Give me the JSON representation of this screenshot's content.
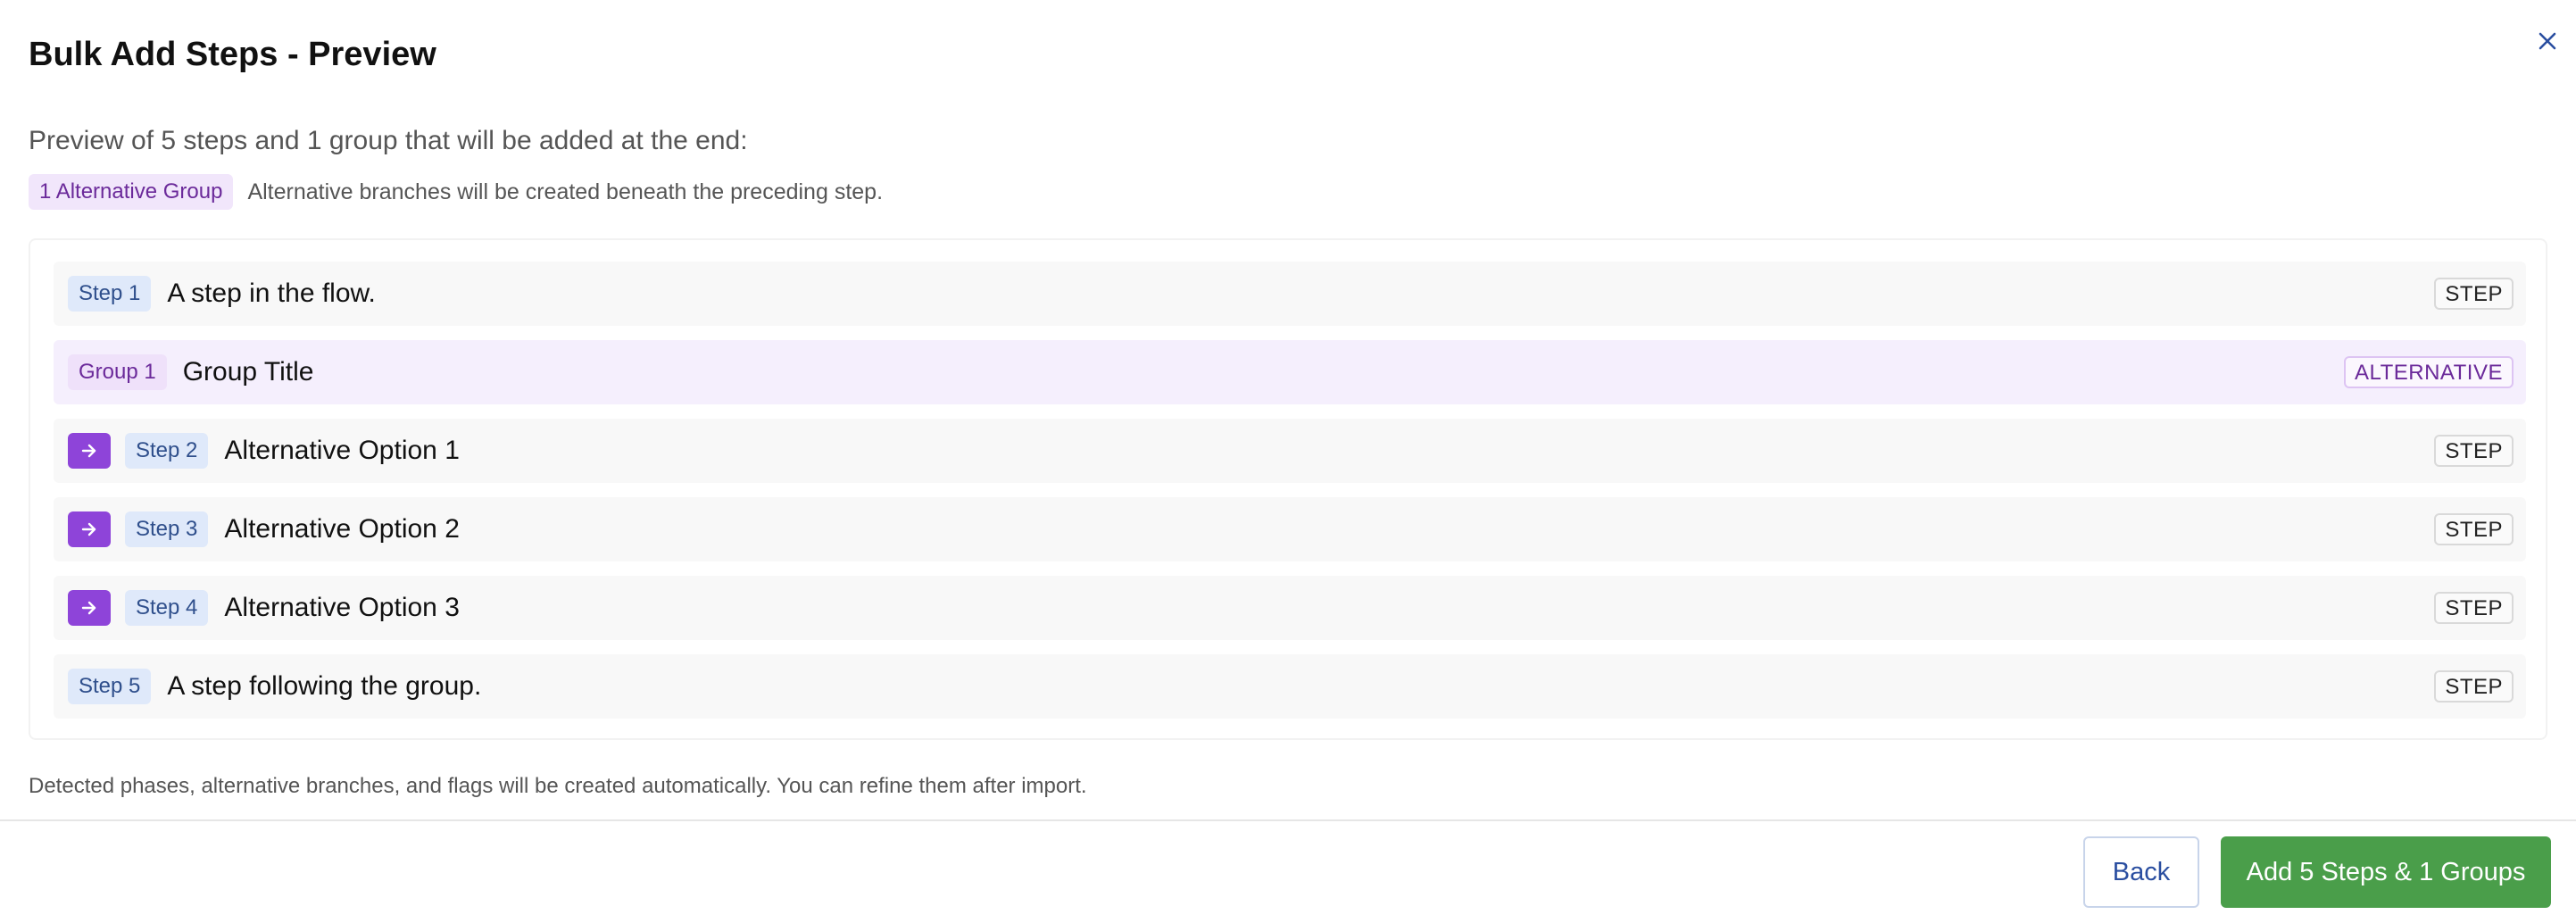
{
  "dialog": {
    "title": "Bulk Add Steps - Preview",
    "close_icon": "close-icon",
    "subtitle": "Preview of 5 steps and 1 group that will be added at the end:",
    "summary": {
      "badge": "1 Alternative Group",
      "text": "Alternative branches will be created beneath the preceding step."
    },
    "rows": [
      {
        "badge": "Step 1",
        "text": "A step in the flow.",
        "type": "STEP"
      },
      {
        "badge": "Group 1",
        "text": "Group Title",
        "type": "ALTERNATIVE"
      },
      {
        "badge": "Step 2",
        "text": "Alternative Option 1",
        "type": "STEP",
        "icon": "arrow-right-icon"
      },
      {
        "badge": "Step 3",
        "text": "Alternative Option 2",
        "type": "STEP",
        "icon": "arrow-right-icon"
      },
      {
        "badge": "Step 4",
        "text": "Alternative Option 3",
        "type": "STEP",
        "icon": "arrow-right-icon"
      },
      {
        "badge": "Step 5",
        "text": "A step following the group.",
        "type": "STEP"
      }
    ],
    "footer_note": "Detected phases, alternative branches, and flags will be created automatically. You can refine them after import.",
    "buttons": {
      "back": "Back",
      "add": "Add 5 Steps & 1 Groups"
    }
  },
  "colors": {
    "accent_purple": "#8e44d9",
    "primary_green": "#4a9e4a",
    "link_blue": "#2a4ea0"
  }
}
